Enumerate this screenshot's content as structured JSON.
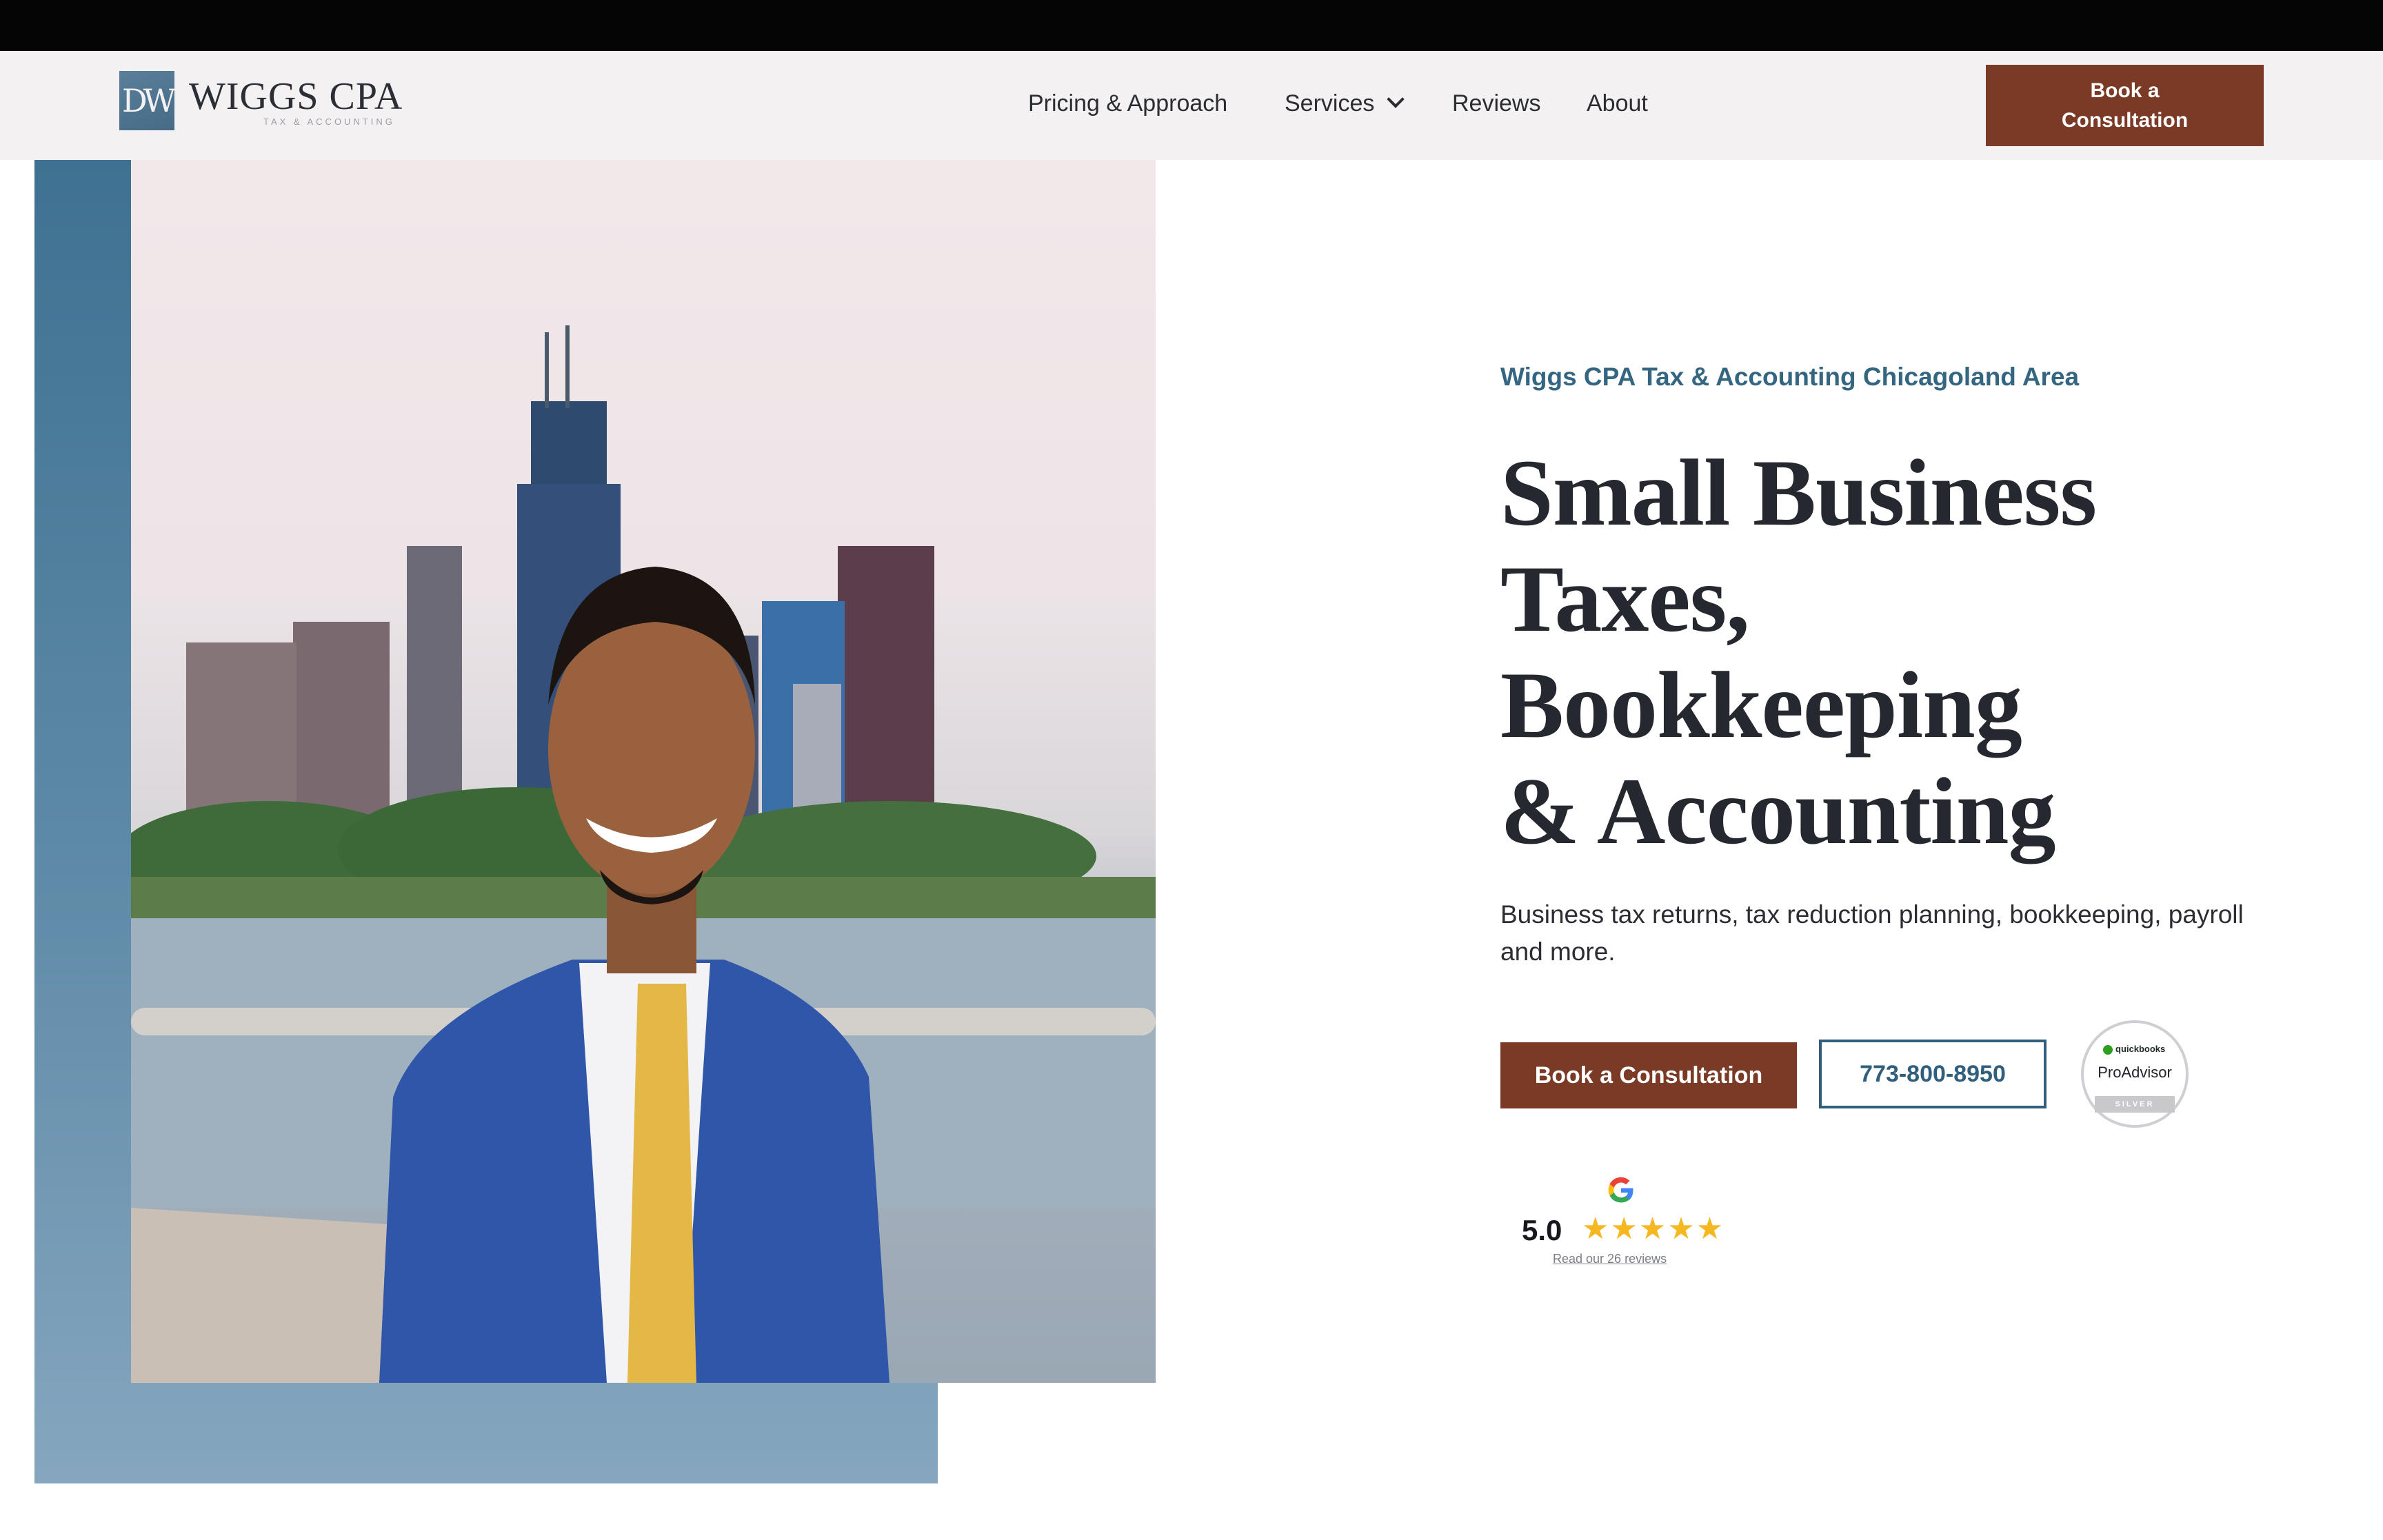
{
  "brand": {
    "logo_mark": "DW",
    "name": "WIGGS CPA",
    "tagline": "TAX & ACCOUNTING"
  },
  "nav": {
    "items": [
      {
        "label": "Pricing & Approach"
      },
      {
        "label": "Services"
      },
      {
        "label": "Reviews"
      },
      {
        "label": "About"
      }
    ],
    "cta_label": "Book a Consultation"
  },
  "hero": {
    "eyebrow": "Wiggs CPA Tax & Accounting Chicagoland Area",
    "title_lines": [
      "Small Business",
      "Taxes,",
      "Bookkeeping",
      "& Accounting"
    ],
    "subtitle": "Business tax returns, tax reduction planning, bookkeeping, payroll and more.",
    "primary_cta": "Book a Consultation",
    "phone": "773-800-8950",
    "badge": {
      "brand": "quickbooks",
      "title": "ProAdvisor",
      "level": "SILVER"
    },
    "reviews": {
      "rating": "5.0",
      "stars": "★★★★★",
      "star_count": 5,
      "link_text": "Read our 26 reviews"
    }
  },
  "icons": {
    "services_dropdown": "chevron-down-icon",
    "google": "google-icon"
  },
  "colors": {
    "accent_brown": "#7b3a26",
    "accent_blue": "#346581",
    "star": "#f5b820"
  }
}
